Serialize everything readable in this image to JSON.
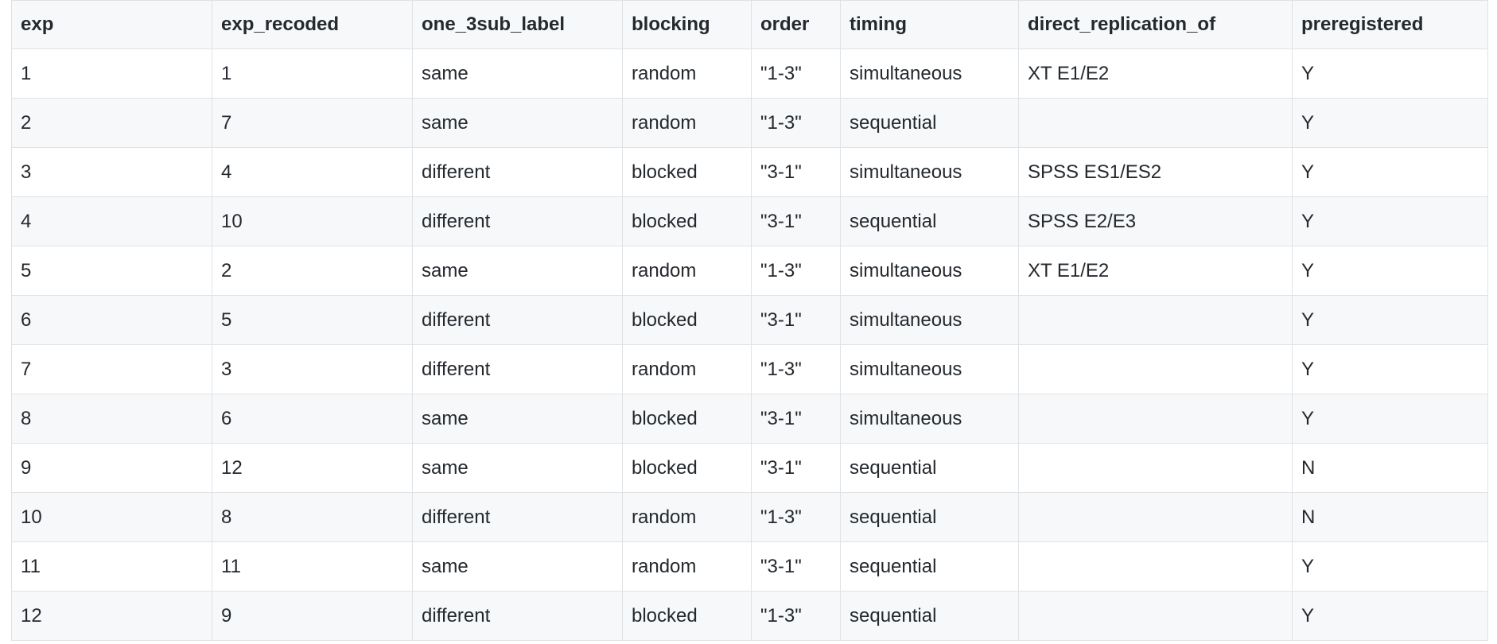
{
  "table": {
    "columns": [
      "exp",
      "exp_recoded",
      "one_3sub_label",
      "blocking",
      "order",
      "timing",
      "direct_replication_of",
      "preregistered"
    ],
    "rows": [
      [
        "1",
        "1",
        "same",
        "random",
        "\"1-3\"",
        "simultaneous",
        "XT E1/E2",
        "Y"
      ],
      [
        "2",
        "7",
        "same",
        "random",
        "\"1-3\"",
        "sequential",
        "",
        "Y"
      ],
      [
        "3",
        "4",
        "different",
        "blocked",
        "\"3-1\"",
        "simultaneous",
        "SPSS ES1/ES2",
        "Y"
      ],
      [
        "4",
        "10",
        "different",
        "blocked",
        "\"3-1\"",
        "sequential",
        "SPSS E2/E3",
        "Y"
      ],
      [
        "5",
        "2",
        "same",
        "random",
        "\"1-3\"",
        "simultaneous",
        "XT E1/E2",
        "Y"
      ],
      [
        "6",
        "5",
        "different",
        "blocked",
        "\"3-1\"",
        "simultaneous",
        "",
        "Y"
      ],
      [
        "7",
        "3",
        "different",
        "random",
        "\"1-3\"",
        "simultaneous",
        "",
        "Y"
      ],
      [
        "8",
        "6",
        "same",
        "blocked",
        "\"3-1\"",
        "simultaneous",
        "",
        "Y"
      ],
      [
        "9",
        "12",
        "same",
        "blocked",
        "\"3-1\"",
        "sequential",
        "",
        "N"
      ],
      [
        "10",
        "8",
        "different",
        "random",
        "\"1-3\"",
        "sequential",
        "",
        "N"
      ],
      [
        "11",
        "11",
        "same",
        "random",
        "\"3-1\"",
        "sequential",
        "",
        "Y"
      ],
      [
        "12",
        "9",
        "different",
        "blocked",
        "\"1-3\"",
        "sequential",
        "",
        "Y"
      ]
    ]
  }
}
